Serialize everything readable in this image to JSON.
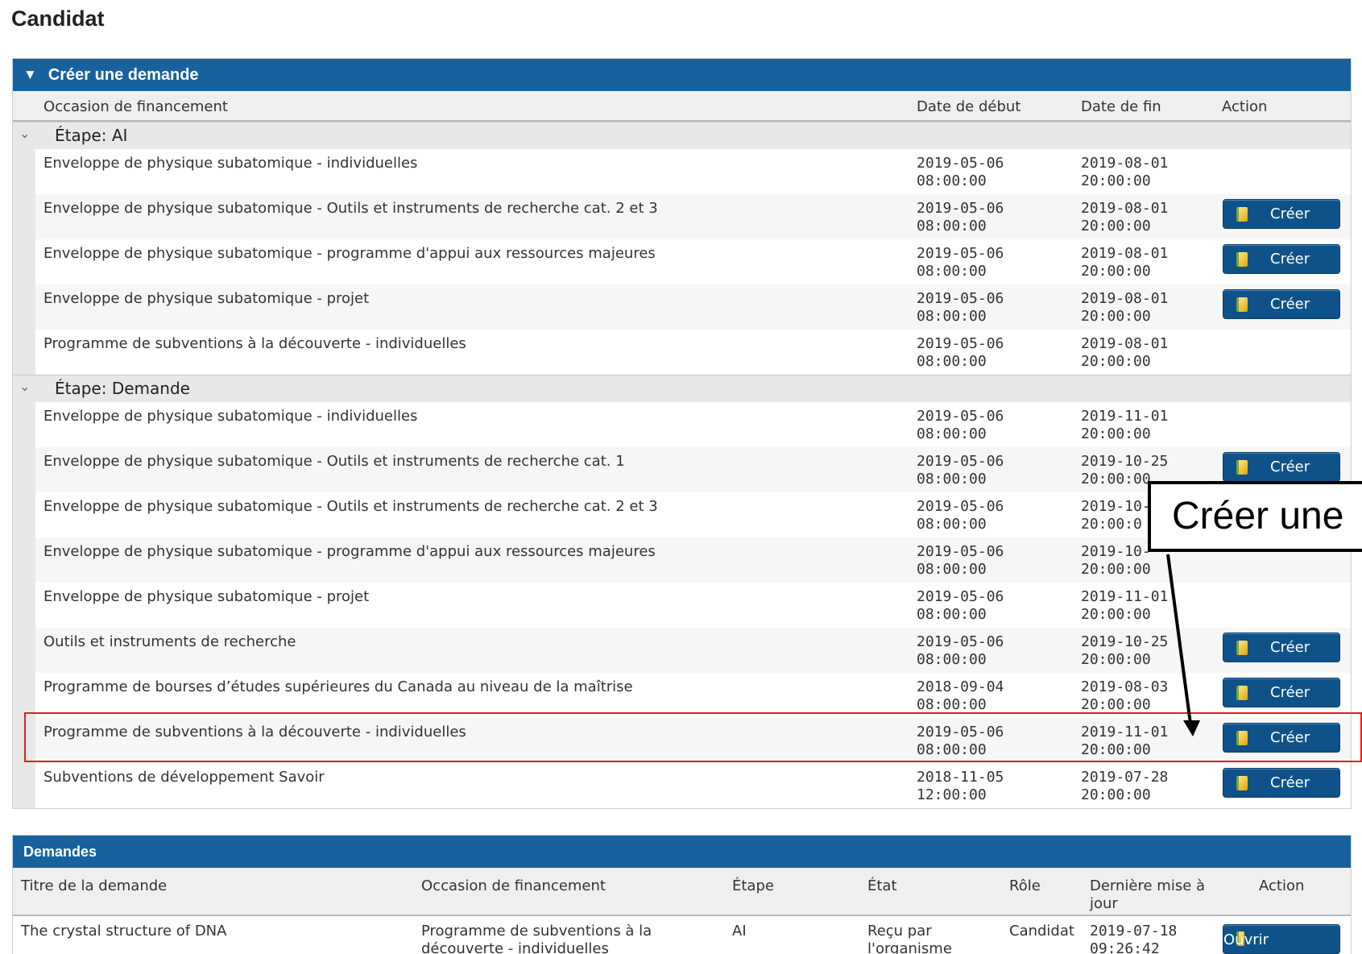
{
  "page": {
    "title": "Candidat"
  },
  "create_section": {
    "title": "Créer une demande",
    "columns": {
      "opportunity": "Occasion de financement",
      "start": "Date de début",
      "end": "Date de fin",
      "action": "Action"
    },
    "button_label": "Créer",
    "groups": [
      {
        "label": "Étape: AI",
        "rows": [
          {
            "name": "Enveloppe de physique subatomique - individuelles",
            "start_date": "2019-05-06",
            "start_time": "08:00:00",
            "end_date": "2019-08-01",
            "end_time": "20:00:00",
            "has_button": false
          },
          {
            "name": "Enveloppe de physique subatomique - Outils et instruments de recherche cat. 2 et 3",
            "start_date": "2019-05-06",
            "start_time": "08:00:00",
            "end_date": "2019-08-01",
            "end_time": "20:00:00",
            "has_button": true
          },
          {
            "name": "Enveloppe de physique subatomique - programme d'appui aux ressources majeures",
            "start_date": "2019-05-06",
            "start_time": "08:00:00",
            "end_date": "2019-08-01",
            "end_time": "20:00:00",
            "has_button": true
          },
          {
            "name": "Enveloppe de physique subatomique - projet",
            "start_date": "2019-05-06",
            "start_time": "08:00:00",
            "end_date": "2019-08-01",
            "end_time": "20:00:00",
            "has_button": true
          },
          {
            "name": "Programme de subventions à la découverte - individuelles",
            "start_date": "2019-05-06",
            "start_time": "08:00:00",
            "end_date": "2019-08-01",
            "end_time": "20:00:00",
            "has_button": false
          }
        ]
      },
      {
        "label": "Étape: Demande",
        "rows": [
          {
            "name": "Enveloppe de physique subatomique - individuelles",
            "start_date": "2019-05-06",
            "start_time": "08:00:00",
            "end_date": "2019-11-01",
            "end_time": "20:00:00",
            "has_button": false
          },
          {
            "name": "Enveloppe de physique subatomique - Outils et instruments de recherche cat. 1",
            "start_date": "2019-05-06",
            "start_time": "08:00:00",
            "end_date": "2019-10-25",
            "end_time": "20:00:00",
            "has_button": true
          },
          {
            "name": "Enveloppe de physique subatomique - Outils et instruments de recherche cat. 2 et 3",
            "start_date": "2019-05-06",
            "start_time": "08:00:00",
            "end_date": "2019-10-",
            "end_time": "20:00:0",
            "has_button": false
          },
          {
            "name": "Enveloppe de physique subatomique - programme d'appui aux ressources majeures",
            "start_date": "2019-05-06",
            "start_time": "08:00:00",
            "end_date": "2019-10-",
            "end_time": "20:00:00",
            "has_button": false
          },
          {
            "name": "Enveloppe de physique subatomique - projet",
            "start_date": "2019-05-06",
            "start_time": "08:00:00",
            "end_date": "2019-11-01",
            "end_time": "20:00:00",
            "has_button": false
          },
          {
            "name": "Outils et instruments de recherche",
            "start_date": "2019-05-06",
            "start_time": "08:00:00",
            "end_date": "2019-10-25",
            "end_time": "20:00:00",
            "has_button": true
          },
          {
            "name": "Programme de bourses d’études supérieures du Canada au niveau de la maîtrise",
            "start_date": "2018-09-04",
            "start_time": "08:00:00",
            "end_date": "2019-08-03",
            "end_time": "20:00:00",
            "has_button": true
          },
          {
            "name": "Programme de subventions à la découverte - individuelles",
            "start_date": "2019-05-06",
            "start_time": "08:00:00",
            "end_date": "2019-11-01",
            "end_time": "20:00:00",
            "has_button": true,
            "highlighted": true
          },
          {
            "name": "Subventions de développement Savoir",
            "start_date": "2018-11-05",
            "start_time": "12:00:00",
            "end_date": "2019-07-28",
            "end_time": "20:00:00",
            "has_button": true
          }
        ]
      }
    ]
  },
  "callout": {
    "text": "Créer une"
  },
  "requests_section": {
    "title": "Demandes",
    "columns": {
      "title": "Titre de la demande",
      "opportunity": "Occasion de financement",
      "stage": "Étape",
      "state": "État",
      "role": "Rôle",
      "last_update": "Dernière mise à jour",
      "action": "Action"
    },
    "rows": [
      {
        "title": "The crystal structure of DNA",
        "opportunity": "Programme de subventions à la découverte - individuelles",
        "stage": "AI",
        "state": "Reçu par l'organisme",
        "role": "Candidat",
        "last_update_date": "2019-07-18",
        "last_update_time": "09:26:42",
        "button_label": "Ouvrir"
      }
    ]
  },
  "colors": {
    "header_blue": "#17629d",
    "button_blue": "#0e5289",
    "highlight_red": "#e02020"
  }
}
